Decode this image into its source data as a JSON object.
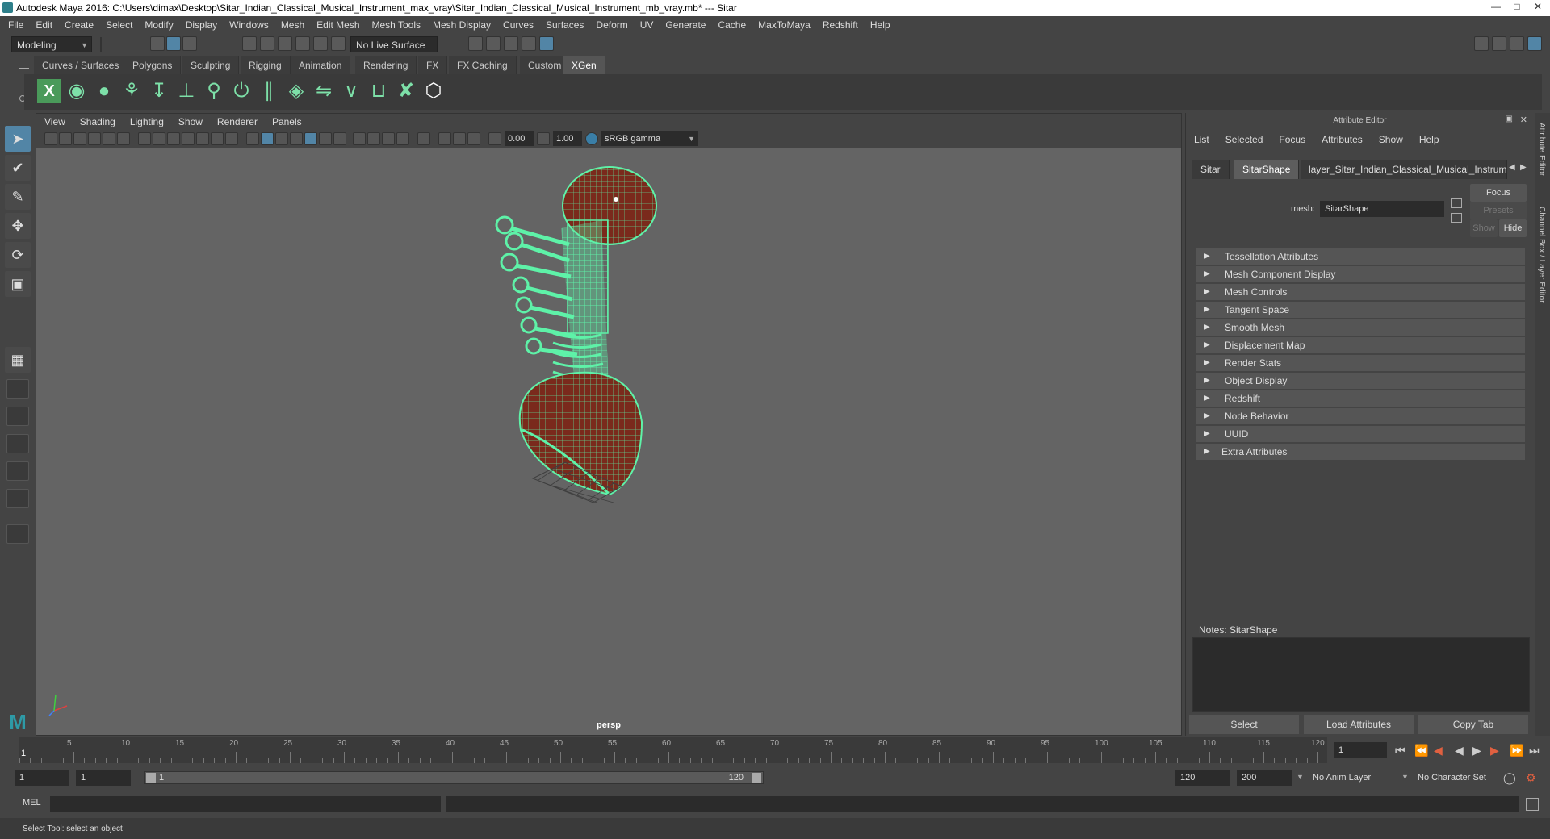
{
  "window": {
    "title": "Autodesk Maya 2016: C:\\Users\\dimax\\Desktop\\Sitar_Indian_Classical_Musical_Instrument_max_vray\\Sitar_Indian_Classical_Musical_Instrument_mb_vray.mb*   ---   Sitar"
  },
  "menubar": [
    "File",
    "Edit",
    "Create",
    "Select",
    "Modify",
    "Display",
    "Windows",
    "Mesh",
    "Edit Mesh",
    "Mesh Tools",
    "Mesh Display",
    "Curves",
    "Surfaces",
    "Deform",
    "UV",
    "Generate",
    "Cache",
    "MaxToMaya",
    "Redshift",
    "Help"
  ],
  "status": {
    "mode": "Modeling",
    "live_surface": "No Live Surface"
  },
  "shelf": {
    "tabs": [
      "Curves / Surfaces",
      "Polygons",
      "Sculpting",
      "Rigging",
      "Animation",
      "Rendering",
      "FX",
      "FX Caching",
      "Custom",
      "XGen"
    ],
    "active_tab": "XGen"
  },
  "viewport": {
    "menu": [
      "View",
      "Shading",
      "Lighting",
      "Show",
      "Renderer",
      "Panels"
    ],
    "exposure": "0.00",
    "gamma": "1.00",
    "colorspace": "sRGB gamma",
    "camera_label": "persp",
    "wireframe_color": "#5ef2a8"
  },
  "attribute_editor": {
    "title": "Attribute Editor",
    "menu": [
      "List",
      "Selected",
      "Focus",
      "Attributes",
      "Show",
      "Help"
    ],
    "tabs": [
      "Sitar",
      "SitarShape",
      "layer_Sitar_Indian_Classical_Musical_Instrument"
    ],
    "active_tab": "SitarShape",
    "mesh_label": "mesh:",
    "mesh_value": "SitarShape",
    "focus_label": "Focus",
    "presets_label": "Presets",
    "show_label": "Show",
    "hide_label": "Hide",
    "sections": [
      "Tessellation Attributes",
      "Mesh Component Display",
      "Mesh Controls",
      "Tangent Space",
      "Smooth Mesh",
      "Displacement Map",
      "Render Stats",
      "Object Display",
      "Redshift",
      "Node Behavior",
      "UUID",
      "Extra Attributes"
    ],
    "notes_label": "Notes:  SitarShape",
    "buttons": [
      "Select",
      "Load Attributes",
      "Copy Tab"
    ],
    "side_tabs": [
      "Attribute Editor",
      "Channel Box / Layer Editor"
    ]
  },
  "timeline": {
    "start_frame_label": "1",
    "ticks": [
      "5",
      "10",
      "15",
      "20",
      "25",
      "30",
      "35",
      "40",
      "45",
      "50",
      "55",
      "60",
      "65",
      "70",
      "75",
      "80",
      "85",
      "90",
      "95",
      "100",
      "105",
      "110",
      "115",
      "120"
    ],
    "current_frame": "1"
  },
  "range": {
    "start": "1",
    "anim_start": "1",
    "slider_start": "1",
    "slider_end": "120",
    "end": "120",
    "anim_end": "200",
    "anim_layer": "No Anim Layer",
    "character_set": "No Character Set"
  },
  "command": {
    "label": "MEL"
  },
  "help_line": "Select Tool: select an object"
}
